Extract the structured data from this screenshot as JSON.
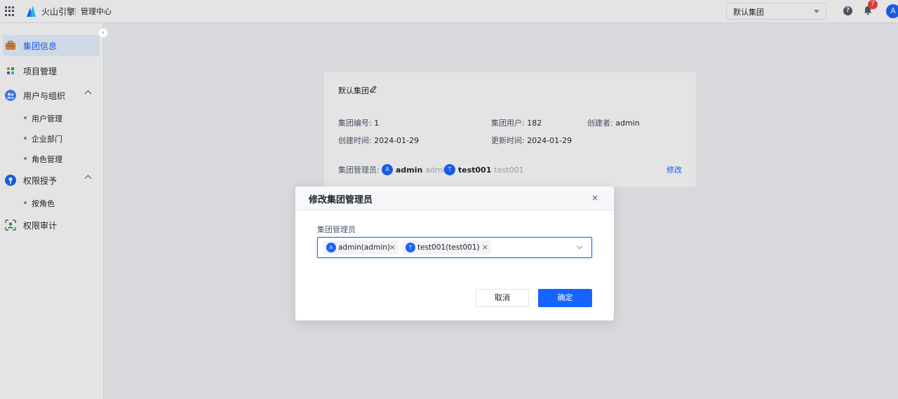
{
  "header": {
    "brand": "火山引擎",
    "subtitle": "管理中心",
    "cluster_selected": "默认集团",
    "notification_count": "7",
    "user_initial": "A"
  },
  "sidebar": {
    "collapse_glyph": "‹",
    "items": [
      {
        "label": "集团信息",
        "icon": "briefcase-icon",
        "active": true
      },
      {
        "label": "项目管理",
        "icon": "project-grid-icon"
      },
      {
        "label": "用户与组织",
        "icon": "users-icon",
        "expanded": true
      },
      {
        "label": "权限授予",
        "icon": "permission-icon",
        "expanded": true
      },
      {
        "label": "权限审计",
        "icon": "audit-icon"
      }
    ],
    "user_org_children": [
      "用户管理",
      "企业部门",
      "角色管理"
    ],
    "permission_children": [
      "按角色"
    ]
  },
  "card": {
    "title": "默认集团",
    "group_id_label": "集团编号:",
    "group_id": "1",
    "group_users_label": "集团用户:",
    "group_users": "182",
    "creator_label": "创建者:",
    "creator": "admin",
    "created_label": "创建时间:",
    "created": "2024-01-29",
    "updated_label": "更新时间:",
    "updated": "2024-01-29",
    "admins_label": "集团管理员:",
    "admins": [
      {
        "initial": "A",
        "name": "admin",
        "sub": "admin"
      },
      {
        "initial": "T",
        "name": "test001",
        "sub": "test001"
      }
    ],
    "edit_link": "修改"
  },
  "modal": {
    "title": "修改集团管理员",
    "close_glyph": "×",
    "field_label": "集团管理员",
    "selected_tags": [
      {
        "initial": "A",
        "label": "admin(admin)"
      },
      {
        "initial": "T",
        "label": "test001(test001)"
      }
    ],
    "tag_remove_glyph": "×",
    "cancel_label": "取消",
    "ok_label": "确定"
  },
  "colors": {
    "primary": "#1664ff",
    "badge": "#f53f3f",
    "active_bg": "#e8f3ff"
  }
}
